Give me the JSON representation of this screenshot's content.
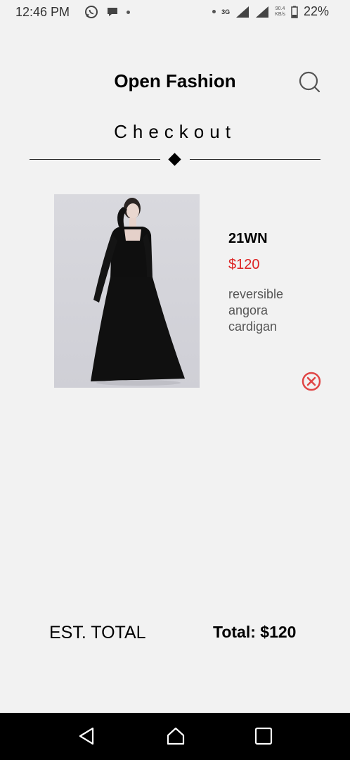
{
  "status_bar": {
    "time": "12:46 PM",
    "network": "3G",
    "net_speed_value": "90.4",
    "net_speed_unit": "KB/s",
    "battery": "22%"
  },
  "header": {
    "brand": "Open Fashion",
    "search_icon": "search-icon"
  },
  "page": {
    "title": "Checkout"
  },
  "cart": {
    "items": [
      {
        "brand": "21WN",
        "price": "$120",
        "description": "reversible angora cardigan",
        "remove_icon": "close-circle-icon"
      }
    ]
  },
  "summary": {
    "est_total_label": "EST. TOTAL",
    "total_text": "Total: $120"
  },
  "colors": {
    "background": "#f2f2f2",
    "price": "#dd2222",
    "remove_icon": "#e04545",
    "nav_bar": "#000000"
  },
  "nav_bar": {
    "back_icon": "back-triangle-icon",
    "home_icon": "home-icon",
    "recent_icon": "recent-apps-icon"
  }
}
